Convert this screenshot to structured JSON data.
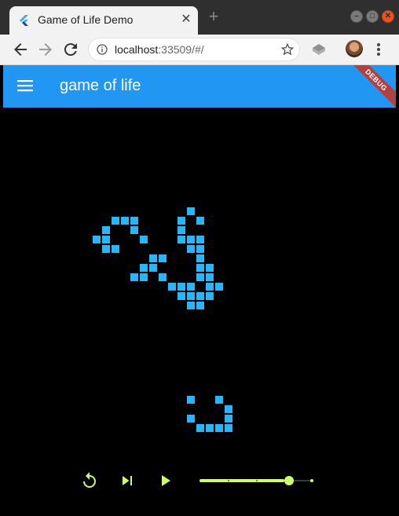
{
  "browser": {
    "tab_title": "Game of Life Demo",
    "url_host": "localhost",
    "url_rest": ":33509/#/"
  },
  "app": {
    "title": "game of life",
    "debug_banner": "DEBUG"
  },
  "colors": {
    "appbar": "#2196f3",
    "cell": "#29b6f6",
    "control_accent": "#ccff66",
    "board_background": "#000000"
  },
  "controls": {
    "reset_icon": "replay-icon",
    "step_icon": "skip-next-icon",
    "play_icon": "play-icon",
    "speed_slider_value": 0.75
  },
  "board": {
    "live_cells": [
      [
        12,
        12
      ],
      [
        13,
        12
      ],
      [
        14,
        12
      ],
      [
        11,
        13
      ],
      [
        14,
        13
      ],
      [
        10,
        14
      ],
      [
        11,
        14
      ],
      [
        15,
        14
      ],
      [
        11,
        15
      ],
      [
        12,
        15
      ],
      [
        20,
        11
      ],
      [
        19,
        12
      ],
      [
        21,
        12
      ],
      [
        19,
        13
      ],
      [
        19,
        14
      ],
      [
        20,
        14
      ],
      [
        21,
        14
      ],
      [
        20,
        15
      ],
      [
        21,
        15
      ],
      [
        16,
        16
      ],
      [
        17,
        16
      ],
      [
        15,
        17
      ],
      [
        16,
        17
      ],
      [
        21,
        16
      ],
      [
        14,
        18
      ],
      [
        15,
        18
      ],
      [
        17,
        18
      ],
      [
        21,
        17
      ],
      [
        22,
        17
      ],
      [
        22,
        18
      ],
      [
        21,
        18
      ],
      [
        18,
        19
      ],
      [
        19,
        19
      ],
      [
        20,
        19
      ],
      [
        22,
        19
      ],
      [
        23,
        19
      ],
      [
        19,
        20
      ],
      [
        20,
        20
      ],
      [
        21,
        20
      ],
      [
        22,
        20
      ],
      [
        20,
        21
      ],
      [
        21,
        21
      ],
      [
        20,
        31
      ],
      [
        23,
        31
      ],
      [
        20,
        33
      ],
      [
        21,
        34
      ],
      [
        22,
        34
      ],
      [
        23,
        34
      ],
      [
        24,
        33
      ],
      [
        24,
        34
      ],
      [
        24,
        32
      ]
    ]
  }
}
